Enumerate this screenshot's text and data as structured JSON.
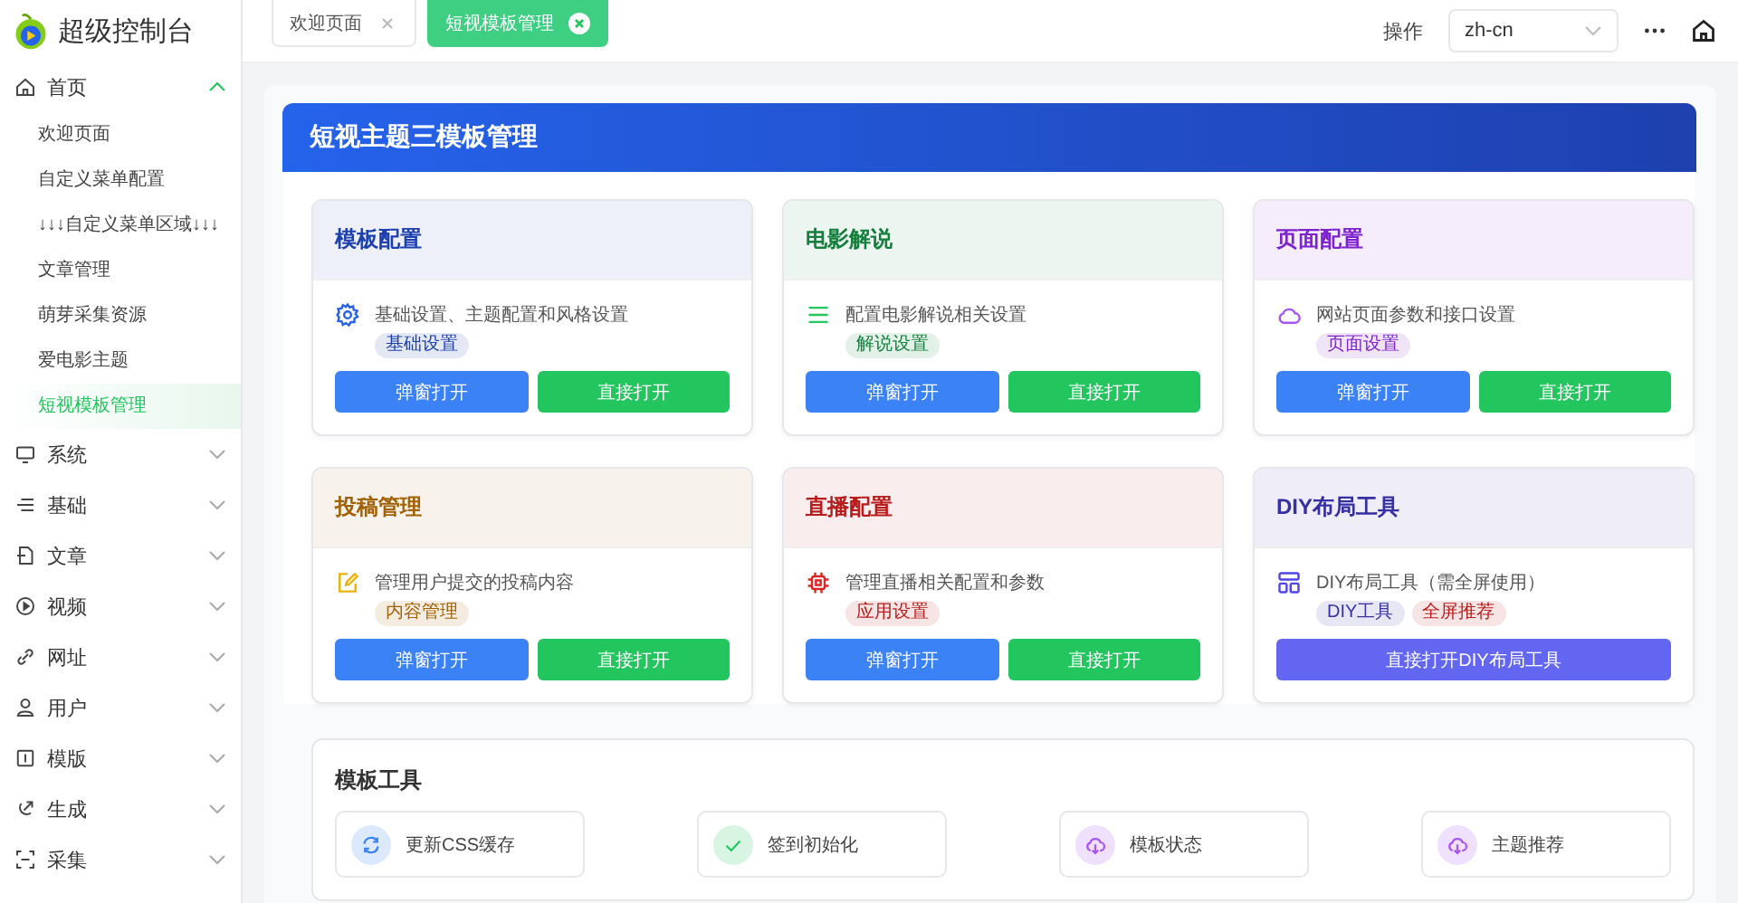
{
  "brand": {
    "title": "超级控制台"
  },
  "sidebar": {
    "items": [
      {
        "label": "首页",
        "expanded": true,
        "children": [
          {
            "label": "欢迎页面",
            "selected": false
          },
          {
            "label": "自定义菜单配置",
            "selected": false
          },
          {
            "label": "↓↓↓自定义菜单区域↓↓↓",
            "selected": false
          },
          {
            "label": "文章管理",
            "selected": false
          },
          {
            "label": "萌芽采集资源",
            "selected": false
          },
          {
            "label": "爱电影主题",
            "selected": false
          },
          {
            "label": "短视模板管理",
            "selected": true
          }
        ]
      },
      {
        "label": "系统",
        "expanded": false
      },
      {
        "label": "基础",
        "expanded": false
      },
      {
        "label": "文章",
        "expanded": false
      },
      {
        "label": "视频",
        "expanded": false
      },
      {
        "label": "网址",
        "expanded": false
      },
      {
        "label": "用户",
        "expanded": false
      },
      {
        "label": "模版",
        "expanded": false
      },
      {
        "label": "生成",
        "expanded": false
      },
      {
        "label": "采集",
        "expanded": false
      }
    ]
  },
  "tabs": [
    {
      "label": "欢迎页面",
      "selected": false
    },
    {
      "label": "短视模板管理",
      "selected": true
    }
  ],
  "header": {
    "action_label": "操作",
    "language": "zh-cn"
  },
  "panel": {
    "title": "短视主题三模板管理",
    "cards": [
      {
        "title": "模板配置",
        "color": "#1e40af",
        "description": "基础设置、主题配置和风格设置",
        "tags": [
          {
            "label": "基础设置",
            "color": "#1e40af"
          }
        ],
        "buttons": [
          {
            "label": "弹窗打开",
            "kind": "popup"
          },
          {
            "label": "直接打开",
            "kind": "direct"
          }
        ]
      },
      {
        "title": "电影解说",
        "color": "#15803d",
        "description": "配置电影解说相关设置",
        "tags": [
          {
            "label": "解说设置",
            "color": "#15803d"
          }
        ],
        "buttons": [
          {
            "label": "弹窗打开",
            "kind": "popup"
          },
          {
            "label": "直接打开",
            "kind": "direct"
          }
        ]
      },
      {
        "title": "页面配置",
        "color": "#7e22ce",
        "description": "网站页面参数和接口设置",
        "tags": [
          {
            "label": "页面设置",
            "color": "#7e22ce"
          }
        ],
        "buttons": [
          {
            "label": "弹窗打开",
            "kind": "popup"
          },
          {
            "label": "直接打开",
            "kind": "direct"
          }
        ]
      },
      {
        "title": "投稿管理",
        "color": "#a16207",
        "description": "管理用户提交的投稿内容",
        "tags": [
          {
            "label": "内容管理",
            "color": "#a16207"
          }
        ],
        "buttons": [
          {
            "label": "弹窗打开",
            "kind": "popup"
          },
          {
            "label": "直接打开",
            "kind": "direct"
          }
        ]
      },
      {
        "title": "直播配置",
        "color": "#b91c1c",
        "description": "管理直播相关配置和参数",
        "tags": [
          {
            "label": "应用设置",
            "color": "#b91c1c"
          }
        ],
        "buttons": [
          {
            "label": "弹窗打开",
            "kind": "popup"
          },
          {
            "label": "直接打开",
            "kind": "direct"
          }
        ]
      },
      {
        "title": "DIY布局工具",
        "color": "#3730a3",
        "description": "DIY布局工具（需全屏使用）",
        "tags": [
          {
            "label": "DIY工具",
            "color": "#3730a3"
          },
          {
            "label": "全屏推荐",
            "color": "#b91c1c"
          }
        ],
        "buttons": [
          {
            "label": "直接打开DIY布局工具",
            "kind": "wide"
          }
        ]
      }
    ],
    "tools": {
      "title": "模板工具",
      "items": [
        {
          "label": "更新CSS缓存",
          "color": "#3b82f6"
        },
        {
          "label": "签到初始化",
          "color": "#22c55e"
        },
        {
          "label": "模板状态",
          "color": "#a855f7"
        },
        {
          "label": "主题推荐",
          "color": "#a855f7"
        }
      ]
    }
  }
}
